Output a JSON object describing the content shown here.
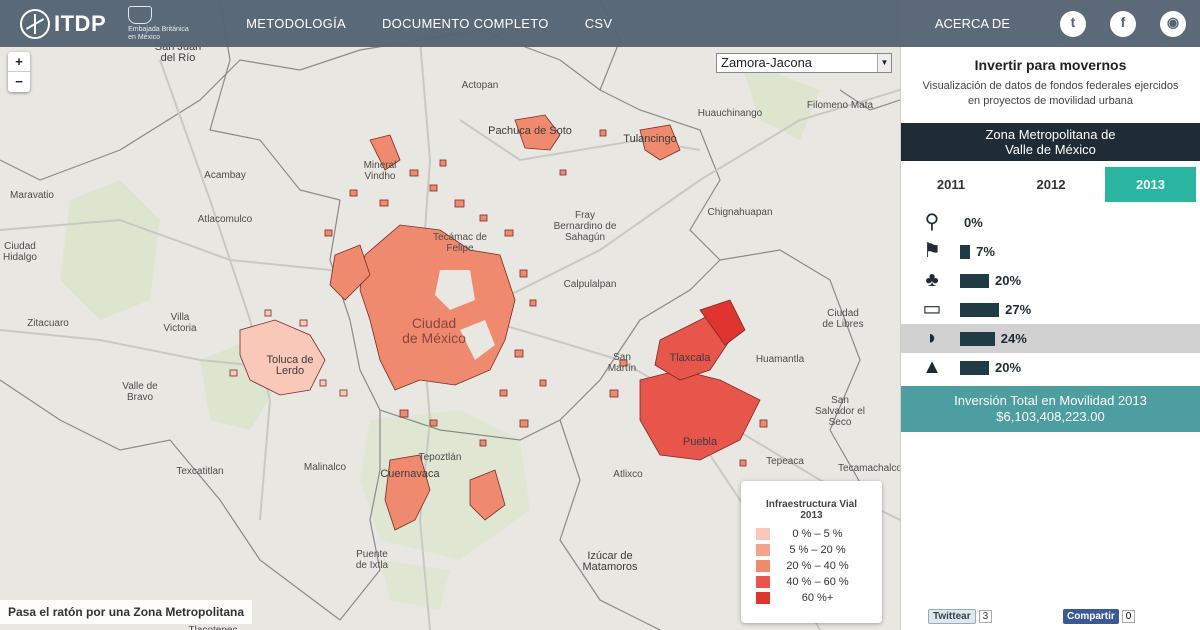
{
  "header": {
    "logo_text": "ITDP",
    "embassy_label": "Embajada Británica en México",
    "nav": [
      "METODOLOGÍA",
      "DOCUMENTO COMPLETO",
      "CSV"
    ],
    "about": "ACERCA DE",
    "social": [
      {
        "icon": "twitter-icon",
        "glyph": "t"
      },
      {
        "icon": "facebook-icon",
        "glyph": "f"
      },
      {
        "icon": "github-icon",
        "glyph": "◉"
      }
    ]
  },
  "map": {
    "zoom_in": "+",
    "zoom_out": "−",
    "zone_select_value": "Zamora-Jacona",
    "hover_hint": "Pasa el ratón por una Zona Metropolitana",
    "places": [
      {
        "name": "San Juan\ndel Río",
        "cls": "mid"
      },
      {
        "name": "Actopan",
        "cls": ""
      },
      {
        "name": "Huauchinango",
        "cls": ""
      },
      {
        "name": "Filomeno Mata",
        "cls": ""
      },
      {
        "name": "Tulancingo",
        "cls": "mid"
      },
      {
        "name": "Pachuca de Soto",
        "cls": "mid"
      },
      {
        "name": "Mineral\nVindho",
        "cls": ""
      },
      {
        "name": "Acambay",
        "cls": ""
      },
      {
        "name": "Maravatio",
        "cls": ""
      },
      {
        "name": "Atlacomulco",
        "cls": ""
      },
      {
        "name": "Chignahuapan",
        "cls": ""
      },
      {
        "name": "Fray\nBernardino de\nSahagún",
        "cls": ""
      },
      {
        "name": "Tecámac de\nFelipe",
        "cls": ""
      },
      {
        "name": "Ciudad\nHidalgo",
        "cls": ""
      },
      {
        "name": "Toluca de\nLerdo",
        "cls": "mid"
      },
      {
        "name": "Calpulalpan",
        "cls": ""
      },
      {
        "name": "Zitacuaro",
        "cls": ""
      },
      {
        "name": "Villa\nVictoria",
        "cls": ""
      },
      {
        "name": "Ciudad\nde México",
        "cls": "big"
      },
      {
        "name": "Ciudad\nde Libres",
        "cls": ""
      },
      {
        "name": "Valle de\nBravo",
        "cls": ""
      },
      {
        "name": "San\nMartín",
        "cls": ""
      },
      {
        "name": "Tlaxcala",
        "cls": "mid"
      },
      {
        "name": "Huamantla",
        "cls": ""
      },
      {
        "name": "San\nSalvador el\nSeco",
        "cls": ""
      },
      {
        "name": "Puebla",
        "cls": "mid"
      },
      {
        "name": "Tepeaca",
        "cls": ""
      },
      {
        "name": "Tecamachalco",
        "cls": ""
      },
      {
        "name": "Malinalco",
        "cls": ""
      },
      {
        "name": "Tepoztlán",
        "cls": ""
      },
      {
        "name": "Texcatitlan",
        "cls": ""
      },
      {
        "name": "Cuernavaca",
        "cls": "mid"
      },
      {
        "name": "Atlixco",
        "cls": ""
      },
      {
        "name": "Puente\nde Ixtla",
        "cls": ""
      },
      {
        "name": "Izúcar de\nMatamoros",
        "cls": "mid"
      },
      {
        "name": "Tlacotepec",
        "cls": ""
      }
    ]
  },
  "legend": {
    "title": "Infraestructura Vial\n2013",
    "items": [
      {
        "label": "0 % – 5 %",
        "color": "#f9c8b8"
      },
      {
        "label": "5 % – 20 %",
        "color": "#f1a58c"
      },
      {
        "label": "20 % – 40 %",
        "color": "#ef8a6e"
      },
      {
        "label": "40 % – 60 %",
        "color": "#e8554a"
      },
      {
        "label": "60 %+",
        "color": "#e0342e"
      }
    ]
  },
  "panel": {
    "title": "Invertir para movernos",
    "subtitle": "Visualización de datos de fondos federales ejercidos en proyectos de movilidad urbana",
    "zone_name": "Zona Metropolitana de\nValle de México",
    "years": [
      "2011",
      "2012",
      "2013"
    ],
    "active_year": "2013",
    "categories": [
      {
        "icon": "bicycle-icon",
        "glyph": "⚲",
        "pct": "0%",
        "value": 0
      },
      {
        "icon": "pedestrian-icon",
        "glyph": "⚑",
        "pct": "7%",
        "value": 7
      },
      {
        "icon": "tree-icon",
        "glyph": "♣",
        "pct": "20%",
        "value": 20
      },
      {
        "icon": "bus-icon",
        "glyph": "▭",
        "pct": "27%",
        "value": 27
      },
      {
        "icon": "car-icon",
        "glyph": "◗",
        "pct": "24%",
        "value": 24
      },
      {
        "icon": "road-icon",
        "glyph": "▲",
        "pct": "20%",
        "value": 20
      }
    ],
    "highlighted_category": "car-icon",
    "total_label": "Inversión Total en Movilidad 2013",
    "total_value": "$6,103,408,223.00",
    "tweet_label": "Twittear",
    "tweet_count": "3",
    "share_label": "Compartir",
    "share_count": "0"
  },
  "colors": {
    "header_bg": "#546474",
    "accent": "#2ab5a0",
    "zone_bar": "#1f2c35",
    "total_bar": "#4d9ea0"
  }
}
